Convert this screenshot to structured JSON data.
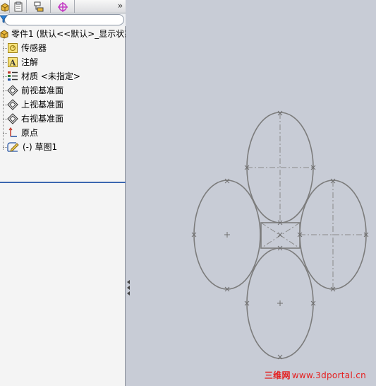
{
  "tabs": [
    {
      "icon": "feature-manager-icon"
    },
    {
      "icon": "property-manager-icon"
    },
    {
      "icon": "configuration-manager-icon"
    },
    {
      "icon": "dimxpert-icon"
    }
  ],
  "tab_overflow": "»",
  "filter": {
    "value": "",
    "icon": "filter-icon"
  },
  "tree": {
    "root": {
      "label": "零件1  (默认<<默认>_显示状态",
      "icon": "part-icon"
    },
    "items": [
      {
        "label": "传感器",
        "icon": "sensor-icon"
      },
      {
        "label": "注解",
        "icon": "annotation-icon"
      },
      {
        "label": "材质 <未指定>",
        "icon": "material-icon"
      },
      {
        "label": "前视基准面",
        "icon": "plane-icon"
      },
      {
        "label": "上视基准面",
        "icon": "plane-icon"
      },
      {
        "label": "右视基准面",
        "icon": "plane-icon"
      },
      {
        "label": "原点",
        "icon": "origin-icon"
      },
      {
        "label": "(-) 草图1",
        "icon": "sketch-icon"
      }
    ]
  },
  "watermark": {
    "cn": "三维网",
    "url": "www.3dportal.cn",
    "color": "#e51e1e"
  },
  "colors": {
    "panel": "#f4f4f4",
    "viewport": "#c8ccd6",
    "sketch_line": "#7c7c7c",
    "accent": "#3b66b0"
  }
}
